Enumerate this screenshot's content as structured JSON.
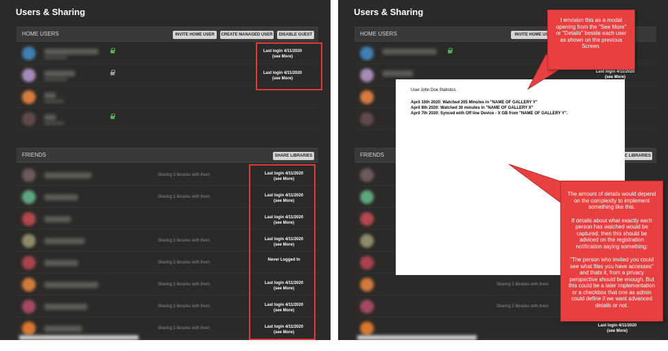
{
  "left": {
    "app_title": "Users & Sharing",
    "home_users": {
      "title": "HOME USERS",
      "buttons": [
        "INVITE HOME USER",
        "CREATE MANAGED USER",
        "DISABLE GUEST"
      ],
      "rows": [
        {
          "login_line1": "Last login 4/11/2020",
          "login_line2": "(see More)"
        },
        {
          "login_line1": "Last login 4/11/2020",
          "login_line2": "(see More)"
        }
      ]
    },
    "friends": {
      "title": "FRIENDS",
      "button": "SHARE LIBRARIES",
      "rows": [
        {
          "sharing": "Sharing 3 libraries with them",
          "login_line1": "Last login 4/11/2020",
          "login_line2": "(see More)"
        },
        {
          "sharing": "Sharing 2 libraries with them",
          "login_line1": "Last login 4/11/2020",
          "login_line2": "(see More)"
        },
        {
          "sharing": "",
          "login_line1": "Last login 4/11/2020",
          "login_line2": "(see More)"
        },
        {
          "sharing": "Sharing 2 libraries with them",
          "login_line1": "Last login 4/11/2020",
          "login_line2": "(see More)"
        },
        {
          "sharing": "Sharing 2 libraries with them",
          "login_line1": "Never Logged In",
          "login_line2": ""
        },
        {
          "sharing": "Sharing 2 libraries with them",
          "login_line1": "Last login 4/11/2020",
          "login_line2": "(see More)"
        },
        {
          "sharing": "Sharing 2 libraries with them",
          "login_line1": "Last login 4/11/2020",
          "login_line2": "(see More)"
        },
        {
          "sharing": "Sharing 2 libraries with them",
          "login_line1": "Last login 4/11/2020",
          "login_line2": "(see More)"
        }
      ]
    }
  },
  "right": {
    "app_title": "Users & Sharing",
    "home_users_title": "HOME USERS",
    "invite_button": "INVITE HOME USE",
    "friends_title": "FRIENDS",
    "share_button": "E LIBRARIES",
    "home_login_line1": "Last login 4/11/2020",
    "home_login_line2": "(see More)",
    "friend_sharing_1": "Sharing 2 libraries with them",
    "friend_sharing_2": "Sharing 2 libraries with them",
    "friend_login_line1": "Last login 4/11/2020",
    "friend_login_line2": "(see More)"
  },
  "modal": {
    "title": "User John Doe Statistics",
    "lines": [
      "April 10th 2020: Watched 205 Minutes in \"NAME OF GALLERY Y\"",
      "April 8th 2020: Watched 30 minutes in \"NAME OF GALLERY X\"",
      "April 7th 2020: Synced with Off line Device - X GB from \"NAME OF GALLERY Y\"."
    ]
  },
  "callouts": {
    "top": "I envision this as a modal opening from the \"See More\" or \"Details\" beside each user as shown on the previous Screen.",
    "bottom_p1": "The amount of details would depend on the complexity to implement something like this.",
    "bottom_p2": "If details about what exactly each person has watched would be captured, then this should be adviced on the registration notification saying something:",
    "bottom_p3": "\"The person who invited you could see what files you have accesses\" and thats it, from a privacy perspective should be enough. But this could be a later implementation or a checkbox that one as admin could define if we want advanced details or not."
  },
  "colors": {
    "panel_bg": "#2b2a28",
    "callout_red": "#e84040",
    "highlight_red": "#e53a3a",
    "lock_green": "#4caf50"
  }
}
